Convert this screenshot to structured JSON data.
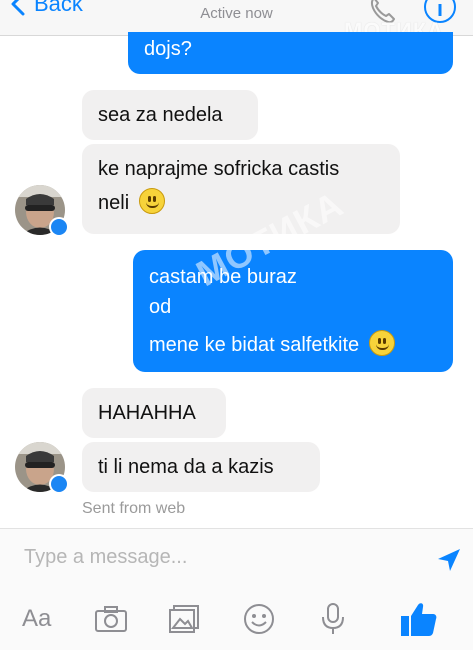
{
  "header": {
    "back_label": "Back",
    "status": "Active now",
    "watermark": "МОТИКА",
    "icons": [
      "chevron-left-icon",
      "phone-icon",
      "info-icon"
    ]
  },
  "messages": [
    {
      "side": "sent",
      "text": "dojs?"
    },
    {
      "side": "received",
      "text": "sea za nedela"
    },
    {
      "side": "received",
      "lines": [
        "ke naprajme sofricka castis",
        "neli"
      ],
      "emoji": "smile"
    },
    {
      "side": "sent",
      "lines": [
        "castam be buraz",
        "od",
        "mene ke bidat salfetkite"
      ],
      "emoji": "smile"
    },
    {
      "side": "received",
      "text": "HAHAHHA"
    },
    {
      "side": "received",
      "text": "ti li nema da a kazis"
    }
  ],
  "watermark_center": "МОТИКА",
  "sent_from": "Sent from web",
  "composer": {
    "placeholder": "Type a message...",
    "toolbar": {
      "aa_label": "Aa",
      "icons": [
        "camera-icon",
        "gallery-icon",
        "emoji-icon",
        "microphone-icon",
        "like-thumb-icon"
      ]
    }
  },
  "colors": {
    "accent": "#0a84ff",
    "received_bubble": "#f1f0f0",
    "sent_text": "#ffffff"
  }
}
